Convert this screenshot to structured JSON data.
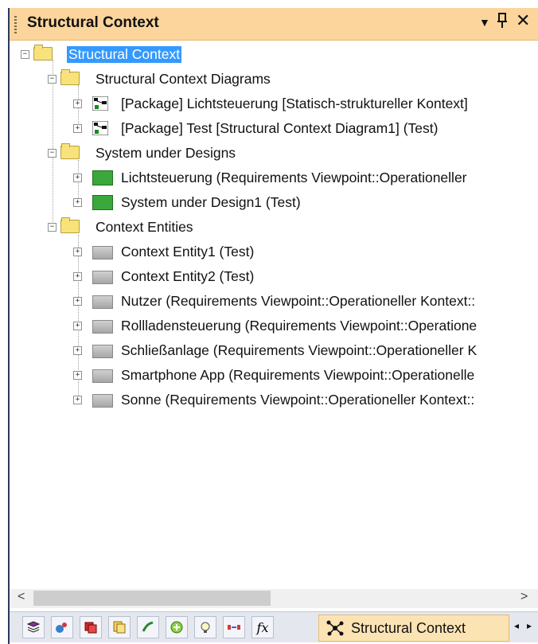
{
  "panel": {
    "title": "Structural Context",
    "buttons": {
      "dropdown": "▼",
      "pin": "ᚁ",
      "close": "✕"
    }
  },
  "tree": {
    "root": {
      "label": "Structural Context",
      "expander": "−",
      "selected": true
    },
    "diagrams": {
      "label": "Structural Context Diagrams",
      "expander": "−",
      "items": [
        {
          "label": "[Package] Lichtsteuerung [Statisch-struktureller Kontext]",
          "expander": "+"
        },
        {
          "label": "[Package] Test [Structural Context Diagram1] (Test)",
          "expander": "+"
        }
      ]
    },
    "systems": {
      "label": "System under Designs",
      "expander": "−",
      "items": [
        {
          "label": "Lichtsteuerung (Requirements Viewpoint::Operationeller",
          "expander": "+"
        },
        {
          "label": "System under Design1 (Test)",
          "expander": "+"
        }
      ]
    },
    "entities": {
      "label": "Context Entities",
      "expander": "−",
      "items": [
        {
          "label": "Context Entity1 (Test)",
          "expander": "+"
        },
        {
          "label": "Context Entity2 (Test)",
          "expander": "+"
        },
        {
          "label": "Nutzer (Requirements Viewpoint::Operationeller Kontext::",
          "expander": "+"
        },
        {
          "label": "Rollladensteuerung (Requirements Viewpoint::Operatione",
          "expander": "+"
        },
        {
          "label": "Schließanlage (Requirements Viewpoint::Operationeller K",
          "expander": "+"
        },
        {
          "label": "Smartphone App (Requirements Viewpoint::Operationelle",
          "expander": "+"
        },
        {
          "label": "Sonne (Requirements Viewpoint::Operationeller Kontext::",
          "expander": "+"
        }
      ]
    }
  },
  "scrollbar": {
    "left": "<",
    "right": ">"
  },
  "tabs": {
    "icons": [
      "book-icon",
      "palette-icon",
      "stack-icon",
      "notes-icon",
      "plugin-icon",
      "add-icon",
      "bulb-icon",
      "trace-icon",
      "function-icon"
    ],
    "function_glyph": "fx",
    "active_label": "Structural Context",
    "nav_left": "◂",
    "nav_right": "▸"
  }
}
